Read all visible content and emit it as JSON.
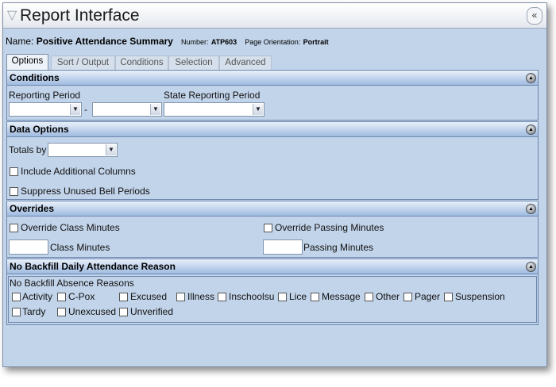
{
  "window": {
    "title": "Report Interface",
    "collapse_glyph": "«",
    "filter_icon": "funnel-icon"
  },
  "report": {
    "name_label": "Name:",
    "name": "Positive Attendance Summary",
    "number_label": "Number:",
    "number": "ATP603",
    "orientation_label": "Page Orientation:",
    "orientation": "Portrait"
  },
  "tabs": [
    {
      "label": "Options",
      "active": true
    },
    {
      "label": "Sort / Output",
      "active": false
    },
    {
      "label": "Conditions",
      "active": false
    },
    {
      "label": "Selection",
      "active": false
    },
    {
      "label": "Advanced",
      "active": false
    }
  ],
  "conditions": {
    "header": "Conditions",
    "reporting_period_label": "Reporting Period",
    "period_separator": "-",
    "reporting_period_start": "",
    "reporting_period_end": "",
    "state_reporting_period_label": "State Reporting Period",
    "state_reporting_period": ""
  },
  "data_options": {
    "header": "Data Options",
    "totals_by_label": "Totals by",
    "totals_by_value": "",
    "include_additional_columns": {
      "label": "Include Additional Columns",
      "checked": false
    },
    "suppress_unused_bell_periods": {
      "label": "Suppress Unused Bell Periods",
      "checked": false
    }
  },
  "overrides": {
    "header": "Overrides",
    "override_class_minutes": {
      "label": "Override Class Minutes",
      "checked": false
    },
    "override_passing_minutes": {
      "label": "Override Passing Minutes",
      "checked": false
    },
    "class_minutes_label": "Class Minutes",
    "class_minutes_value": "",
    "passing_minutes_label": "Passing Minutes",
    "passing_minutes_value": ""
  },
  "backfill": {
    "header": "No Backfill Daily Attendance Reason",
    "group_label": "No Backfill Absence Reasons",
    "reasons": [
      {
        "label": "Activity",
        "checked": false
      },
      {
        "label": "C-Pox",
        "checked": false
      },
      {
        "label": "Excused",
        "checked": false
      },
      {
        "label": "Illness",
        "checked": false
      },
      {
        "label": "Inschoolsu",
        "checked": false
      },
      {
        "label": "Lice",
        "checked": false
      },
      {
        "label": "Message",
        "checked": false
      },
      {
        "label": "Other",
        "checked": false
      },
      {
        "label": "Pager",
        "checked": false
      },
      {
        "label": "Suspension",
        "checked": false
      },
      {
        "label": "Tardy",
        "checked": false
      },
      {
        "label": "Unexcused",
        "checked": false
      },
      {
        "label": "Unverified",
        "checked": false
      }
    ]
  },
  "icons": {
    "section_toggle": "collapse-circle-icon",
    "dropdown": "dropdown-arrow-icon"
  },
  "colors": {
    "panel_bg": "#c2d4ea",
    "section_border": "#6d86ad",
    "header_gradient_bottom": "#9fbbe0"
  }
}
